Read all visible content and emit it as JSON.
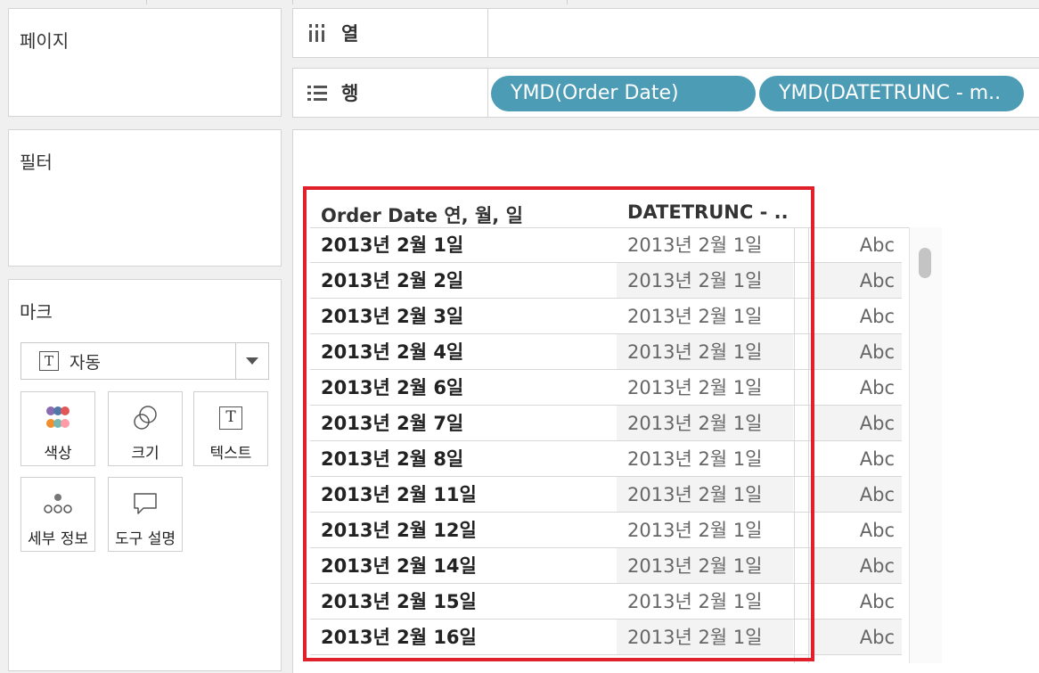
{
  "cards": {
    "pages": {
      "title": "페이지"
    },
    "filters": {
      "title": "필터"
    },
    "marks": {
      "title": "마크",
      "mark_type": "자동",
      "buttons": [
        {
          "label": "색상",
          "icon": "color-icon"
        },
        {
          "label": "크기",
          "icon": "size-icon"
        },
        {
          "label": "텍스트",
          "icon": "text-icon"
        },
        {
          "label": "세부 정보",
          "icon": "detail-icon"
        },
        {
          "label": "도구 설명",
          "icon": "tooltip-icon"
        }
      ]
    }
  },
  "shelves": {
    "columns": {
      "label": "열",
      "icon": "columns-icon"
    },
    "rows": {
      "label": "행",
      "icon": "rows-icon",
      "pills": [
        "YMD(Order Date)",
        "YMD(DATETRUNC - m.."
      ]
    }
  },
  "table": {
    "headers": [
      "Order Date 연, 월, 일",
      "DATETRUNC - .."
    ],
    "rows": [
      {
        "date": "2013년 2월 1일",
        "trunc": "2013년 2월 1일",
        "value": "Abc"
      },
      {
        "date": "2013년 2월 2일",
        "trunc": "2013년 2월 1일",
        "value": "Abc"
      },
      {
        "date": "2013년 2월 3일",
        "trunc": "2013년 2월 1일",
        "value": "Abc"
      },
      {
        "date": "2013년 2월 4일",
        "trunc": "2013년 2월 1일",
        "value": "Abc"
      },
      {
        "date": "2013년 2월 6일",
        "trunc": "2013년 2월 1일",
        "value": "Abc"
      },
      {
        "date": "2013년 2월 7일",
        "trunc": "2013년 2월 1일",
        "value": "Abc"
      },
      {
        "date": "2013년 2월 8일",
        "trunc": "2013년 2월 1일",
        "value": "Abc"
      },
      {
        "date": "2013년 2월 11일",
        "trunc": "2013년 2월 1일",
        "value": "Abc"
      },
      {
        "date": "2013년 2월 12일",
        "trunc": "2013년 2월 1일",
        "value": "Abc"
      },
      {
        "date": "2013년 2월 14일",
        "trunc": "2013년 2월 1일",
        "value": "Abc"
      },
      {
        "date": "2013년 2월 15일",
        "trunc": "2013년 2월 1일",
        "value": "Abc"
      },
      {
        "date": "2013년 2월 16일",
        "trunc": "2013년 2월 1일",
        "value": "Abc"
      }
    ]
  },
  "colors": {
    "pill": "#4d9cb6",
    "highlight": "#e0202a",
    "band": "#f3f3f3"
  }
}
